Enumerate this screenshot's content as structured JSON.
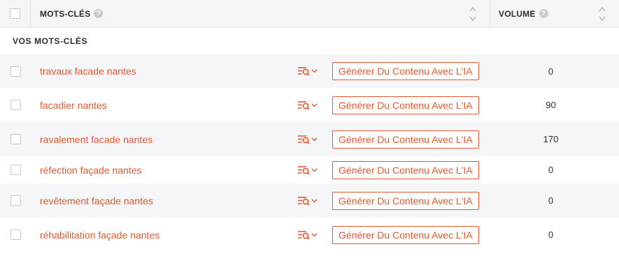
{
  "header": {
    "select_all_label": "",
    "keywords_label": "MOTS-CLÉS",
    "volume_label": "VOLUME",
    "help_glyph": "?"
  },
  "section": {
    "label": "VOS MOTS-CLÉS"
  },
  "rows": [
    {
      "keyword": "travaux facade nantes",
      "button": "Générer Du Contenu Avec L'IA",
      "volume": "0"
    },
    {
      "keyword": "facadier nantes",
      "button": "Générer Du Contenu Avec L'IA",
      "volume": "90"
    },
    {
      "keyword": "ravalement facade nantes",
      "button": "Générer Du Contenu Avec L'IA",
      "volume": "170"
    },
    {
      "keyword": "réfection façade nantes",
      "button": "Générer Du Contenu Avec L'IA",
      "volume": "0"
    },
    {
      "keyword": "revêtement façade nantes",
      "button": "Générer Du Contenu Avec L'IA",
      "volume": "0"
    },
    {
      "keyword": "réhabilitation façade nantes",
      "button": "Générer Du Contenu Avec L'IA",
      "volume": "0"
    }
  ],
  "colors": {
    "accent": "#e4572e",
    "header_bg": "#f4f5f6",
    "alt_row_bg": "#f5f6f7"
  },
  "icons": {
    "row_tool": "search-list-icon",
    "sort": "sort-icon",
    "help": "help-icon"
  }
}
